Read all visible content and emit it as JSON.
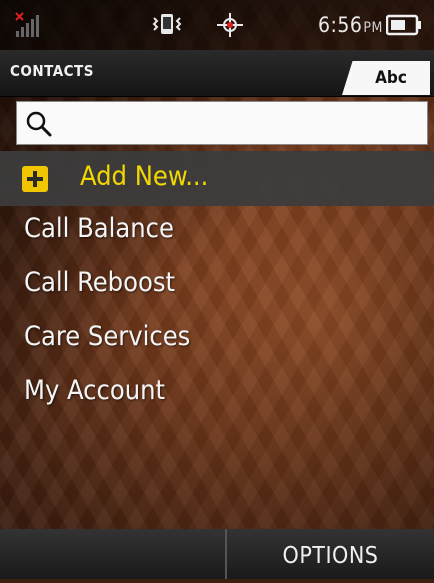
{
  "status_bar": {
    "time": "6:56",
    "ampm": "PM",
    "icons": [
      "no-signal-icon",
      "vibrate-icon",
      "gps-icon",
      "battery-icon"
    ]
  },
  "header": {
    "title": "CONTACTS",
    "input_mode": "Abc"
  },
  "search": {
    "placeholder": ""
  },
  "add_new": {
    "label": "Add New..."
  },
  "contacts": [
    {
      "label": "Call Balance"
    },
    {
      "label": "Call Reboost"
    },
    {
      "label": "Care Services"
    },
    {
      "label": "My Account"
    }
  ],
  "softkeys": {
    "left": "",
    "right": "OPTIONS"
  },
  "colors": {
    "highlight_text": "#f2d800",
    "add_icon": "#f0c600",
    "wallpaper": "#7a3d1d"
  }
}
